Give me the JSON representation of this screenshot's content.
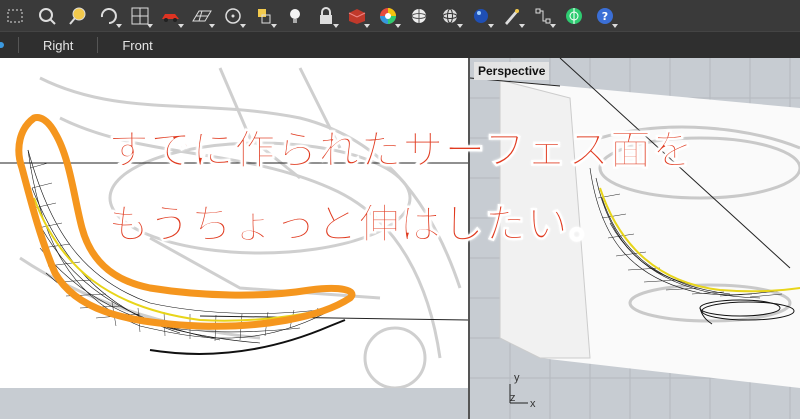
{
  "toolbar": {
    "icons": [
      "polygon-tool-icon",
      "zoom-extents-icon",
      "zoom-icon",
      "rotate-view-icon",
      "viewport-layout-icon",
      "car-icon",
      "grid-plane-icon",
      "target-icon",
      "layer-icon",
      "light-bulb-icon",
      "lock-icon",
      "material-swatch-icon",
      "color-wheel-icon",
      "sphere-wireframe-icon",
      "sphere-shaded-icon",
      "blue-sphere-icon",
      "render-icon",
      "snap-icon",
      "gumball-icon",
      "help-icon"
    ]
  },
  "tabs": {
    "right": "Right",
    "front": "Front"
  },
  "viewports": {
    "perspective_label": "Perspective"
  },
  "overlay": {
    "line1": "すでに作られたサーフェス面を",
    "line2": "もうちょっと伸ばしたい。"
  },
  "axis": {
    "x": "x",
    "y": "y",
    "z": "z"
  },
  "colors": {
    "overlay_text": "#e03a1f",
    "highlight": "#f5961e",
    "toolbar": "#3a3a3a"
  }
}
